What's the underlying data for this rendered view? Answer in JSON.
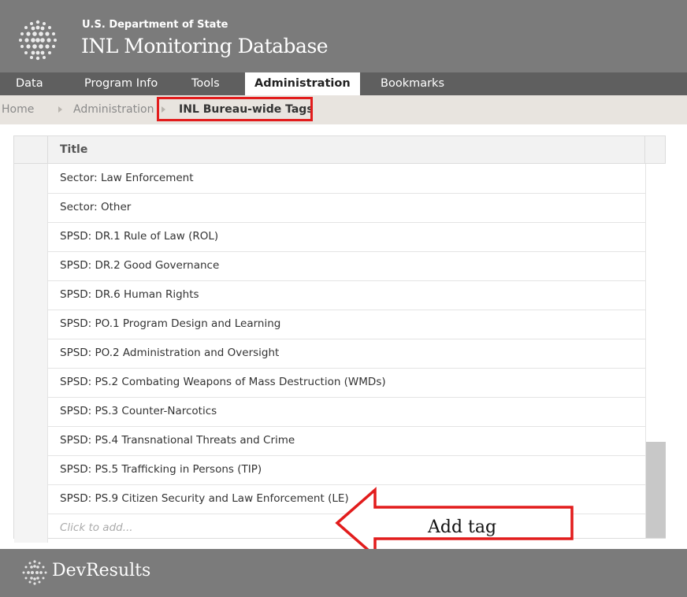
{
  "header": {
    "department": "U.S. Department of State",
    "app_name": "INL Monitoring Database"
  },
  "nav": {
    "items": [
      {
        "label": "Data"
      },
      {
        "label": "Program Info"
      },
      {
        "label": "Tools"
      },
      {
        "label": "Administration",
        "active": true
      },
      {
        "label": "Bookmarks"
      }
    ]
  },
  "breadcrumb": {
    "items": [
      {
        "label": "Home"
      },
      {
        "label": "Administration"
      },
      {
        "label": "INL Bureau-wide Tags"
      }
    ]
  },
  "grid": {
    "column_title": "Title",
    "rows": [
      "Sector: Law Enforcement",
      "Sector: Other",
      "SPSD: DR.1 Rule of Law (ROL)",
      "SPSD: DR.2 Good Governance",
      "SPSD: DR.6 Human Rights",
      "SPSD: PO.1 Program Design and Learning",
      "SPSD: PO.2 Administration and Oversight",
      "SPSD: PS.2 Combating Weapons of Mass Destruction (WMDs)",
      "SPSD: PS.3 Counter-Narcotics",
      "SPSD: PS.4 Transnational Threats and Crime",
      "SPSD: PS.5 Trafficking in Persons (TIP)",
      "SPSD: PS.9 Citizen Security and Law Enforcement (LE)"
    ],
    "add_placeholder": "Click to add..."
  },
  "annotation": {
    "label": "Add tag",
    "color": "#e21c1c"
  },
  "footer": {
    "brand": "DevResults"
  },
  "colors": {
    "header_bg": "#7b7b7b",
    "nav_bg": "#5f5f5f",
    "breadcrumb_bg": "#e8e4df",
    "highlight_red": "#e21c1c"
  }
}
